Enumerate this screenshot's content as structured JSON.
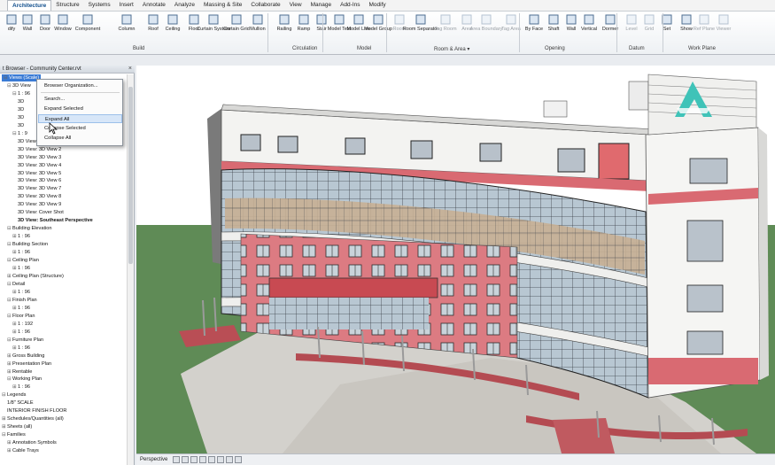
{
  "ribbon": {
    "tabs": [
      {
        "label": "Architecture",
        "active": true
      },
      {
        "label": "Structure"
      },
      {
        "label": "Systems"
      },
      {
        "label": "Insert"
      },
      {
        "label": "Annotate"
      },
      {
        "label": "Analyze"
      },
      {
        "label": "Massing & Site"
      },
      {
        "label": "Collaborate"
      },
      {
        "label": "View"
      },
      {
        "label": "Manage"
      },
      {
        "label": "Add-Ins"
      },
      {
        "label": "Modify"
      }
    ],
    "tools": [
      {
        "label": "dify",
        "icon": "modify-icon"
      },
      {
        "label": "Wall",
        "icon": "wall-icon"
      },
      {
        "label": "Door",
        "icon": "door-icon"
      },
      {
        "label": "Window",
        "icon": "window-icon"
      },
      {
        "label": "Component",
        "icon": "component-icon"
      },
      {
        "label": "Column",
        "icon": "column-icon"
      },
      {
        "label": "Roof",
        "icon": "roof-icon"
      },
      {
        "label": "Ceiling",
        "icon": "ceiling-icon"
      },
      {
        "label": "Floor",
        "icon": "floor-icon"
      },
      {
        "label": "Curtain System",
        "icon": "curtain-system-icon"
      },
      {
        "label": "Curtain Grid",
        "icon": "curtain-grid-icon"
      },
      {
        "label": "Mullion",
        "icon": "mullion-icon"
      },
      {
        "label": "Railing",
        "icon": "railing-icon"
      },
      {
        "label": "Ramp",
        "icon": "ramp-icon"
      },
      {
        "label": "Stair",
        "icon": "stair-icon"
      },
      {
        "label": "Model Text",
        "icon": "model-text-icon"
      },
      {
        "label": "Model Line",
        "icon": "model-line-icon"
      },
      {
        "label": "Model Group",
        "icon": "model-group-icon"
      },
      {
        "label": "Room",
        "icon": "room-icon"
      },
      {
        "label": "Room Separator",
        "icon": "room-separator-icon"
      },
      {
        "label": "Tag Room",
        "icon": "tag-room-icon"
      },
      {
        "label": "Area",
        "icon": "area-icon"
      },
      {
        "label": "Area Boundary",
        "icon": "area-boundary-icon"
      },
      {
        "label": "Tag Area",
        "icon": "tag-area-icon"
      },
      {
        "label": "By Face",
        "icon": "by-face-icon"
      },
      {
        "label": "Shaft",
        "icon": "shaft-icon"
      },
      {
        "label": "Wall",
        "icon": "wall-opening-icon"
      },
      {
        "label": "Vertical",
        "icon": "vertical-icon"
      },
      {
        "label": "Dormer",
        "icon": "dormer-icon"
      },
      {
        "label": "Level",
        "icon": "level-icon"
      },
      {
        "label": "Grid",
        "icon": "grid-icon"
      },
      {
        "label": "Set",
        "icon": "set-icon"
      },
      {
        "label": "Show",
        "icon": "show-icon"
      },
      {
        "label": "Ref Plane",
        "icon": "ref-plane-icon"
      },
      {
        "label": "Viewer",
        "icon": "viewer-icon"
      }
    ],
    "panels": [
      {
        "label": "Build"
      },
      {
        "label": "Circulation"
      },
      {
        "label": "Model"
      },
      {
        "label": "Room & Area ▾"
      },
      {
        "label": "Opening"
      },
      {
        "label": "Datum"
      },
      {
        "label": "Work Plane"
      }
    ]
  },
  "browser": {
    "title": "t Browser - Community Center.rvt",
    "close_glyph": "×",
    "tree": [
      {
        "label": "Views (Scale)",
        "depth": 0,
        "toggle": "⊟",
        "selected": true
      },
      {
        "label": "3D View",
        "depth": 1,
        "toggle": "⊟"
      },
      {
        "label": "1 : 96",
        "depth": 2,
        "toggle": "⊟"
      },
      {
        "label": "3D",
        "depth": 3
      },
      {
        "label": "3D",
        "depth": 3
      },
      {
        "label": "3D",
        "depth": 3
      },
      {
        "label": "3D",
        "depth": 3
      },
      {
        "label": "1 : 9",
        "depth": 2,
        "toggle": "⊟"
      },
      {
        "label": "3D View: 3D View 1",
        "depth": 3
      },
      {
        "label": "3D View: 3D View 2",
        "depth": 3
      },
      {
        "label": "3D View: 3D View 3",
        "depth": 3
      },
      {
        "label": "3D View: 3D View 4",
        "depth": 3
      },
      {
        "label": "3D View: 3D View 5",
        "depth": 3
      },
      {
        "label": "3D View: 3D View 6",
        "depth": 3
      },
      {
        "label": "3D View: 3D View 7",
        "depth": 3
      },
      {
        "label": "3D View: 3D View 8",
        "depth": 3
      },
      {
        "label": "3D View: 3D View 9",
        "depth": 3
      },
      {
        "label": "3D View: Cover Shot",
        "depth": 3
      },
      {
        "label": "3D View: Southeast Perspective",
        "depth": 3,
        "bold": true
      },
      {
        "label": "Building Elevation",
        "depth": 1,
        "toggle": "⊟"
      },
      {
        "label": "1 : 96",
        "depth": 2,
        "toggle": "⊞"
      },
      {
        "label": "Building Section",
        "depth": 1,
        "toggle": "⊟"
      },
      {
        "label": "1 : 96",
        "depth": 2,
        "toggle": "⊞"
      },
      {
        "label": "Ceiling Plan",
        "depth": 1,
        "toggle": "⊟"
      },
      {
        "label": "1 : 96",
        "depth": 2,
        "toggle": "⊞"
      },
      {
        "label": "Ceiling Plan (Structure)",
        "depth": 1,
        "toggle": "⊞"
      },
      {
        "label": "Detail",
        "depth": 1,
        "toggle": "⊟"
      },
      {
        "label": "1 : 96",
        "depth": 2,
        "toggle": "⊞"
      },
      {
        "label": "Finish Plan",
        "depth": 1,
        "toggle": "⊟"
      },
      {
        "label": "1 : 96",
        "depth": 2,
        "toggle": "⊞"
      },
      {
        "label": "Floor Plan",
        "depth": 1,
        "toggle": "⊟"
      },
      {
        "label": "1 : 192",
        "depth": 2,
        "toggle": "⊞"
      },
      {
        "label": "1 : 96",
        "depth": 2,
        "toggle": "⊞"
      },
      {
        "label": "Furniture Plan",
        "depth": 1,
        "toggle": "⊟"
      },
      {
        "label": "1 : 96",
        "depth": 2,
        "toggle": "⊞"
      },
      {
        "label": "Gross Building",
        "depth": 1,
        "toggle": "⊞"
      },
      {
        "label": "Presentation Plan",
        "depth": 1,
        "toggle": "⊞"
      },
      {
        "label": "Rentable",
        "depth": 1,
        "toggle": "⊞"
      },
      {
        "label": "Working Plan",
        "depth": 1,
        "toggle": "⊟"
      },
      {
        "label": "1 : 96",
        "depth": 2,
        "toggle": "⊞"
      },
      {
        "label": "Legends",
        "depth": 0,
        "toggle": "⊟"
      },
      {
        "label": "1/8\" SCALE",
        "depth": 1
      },
      {
        "label": "INTERIOR FINISH FLOOR",
        "depth": 1
      },
      {
        "label": "Schedules/Quantities (all)",
        "depth": 0,
        "toggle": "⊞"
      },
      {
        "label": "Sheets (all)",
        "depth": 0,
        "toggle": "⊞"
      },
      {
        "label": "Families",
        "depth": 0,
        "toggle": "⊟"
      },
      {
        "label": "Annotation Symbols",
        "depth": 1,
        "toggle": "⊞"
      },
      {
        "label": "Cable Trays",
        "depth": 1,
        "toggle": "⊞"
      }
    ]
  },
  "context_menu": {
    "items": [
      {
        "label": "Browser Organization..."
      },
      {
        "label": "Search..."
      },
      {
        "label": "Expand Selected"
      },
      {
        "label": "Expand All",
        "hover": true
      },
      {
        "label": "Collapse Selected"
      },
      {
        "label": "Collapse All"
      }
    ]
  },
  "status": {
    "view_type": "Perspective"
  },
  "colors": {
    "accent": "#3a7bd5",
    "ground": "#5e8a55",
    "plaza": "#d2d0cb",
    "brick": "#d9757c",
    "wall": "#f4f4f2",
    "glass": "#a9bccb",
    "logo": "#33c2b8"
  }
}
